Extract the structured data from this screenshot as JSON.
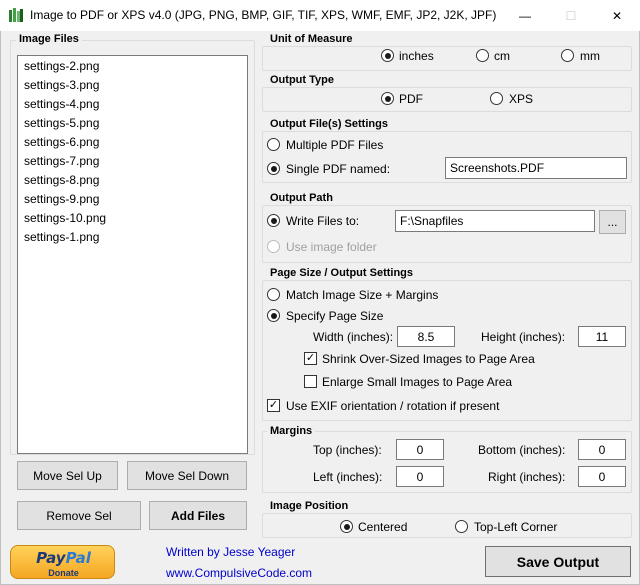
{
  "window": {
    "title": "Image to PDF or XPS  v4.0   (JPG, PNG, BMP, GIF, TIF, XPS, WMF, EMF, JP2, J2K, JPF)",
    "minimize_glyph": "—",
    "maximize_glyph": "☐",
    "close_glyph": "✕"
  },
  "image_files": {
    "title": "Image Files",
    "items": [
      "settings-2.png",
      "settings-3.png",
      "settings-4.png",
      "settings-5.png",
      "settings-6.png",
      "settings-7.png",
      "settings-8.png",
      "settings-9.png",
      "settings-10.png",
      "settings-1.png"
    ],
    "move_up_label": "Move Sel Up",
    "move_down_label": "Move Sel Down",
    "remove_label": "Remove Sel",
    "add_label": "Add Files"
  },
  "unit_of_measure": {
    "title": "Unit of Measure",
    "options": [
      "inches",
      "cm",
      "mm"
    ],
    "selected": "inches"
  },
  "output_type": {
    "title": "Output Type",
    "options": [
      "PDF",
      "XPS"
    ],
    "selected": "PDF"
  },
  "output_file_settings": {
    "title": "Output File(s) Settings",
    "multiple_label": "Multiple PDF Files",
    "single_label": "Single PDF named:",
    "selected": "single",
    "filename": "Screenshots.PDF"
  },
  "output_path": {
    "title": "Output Path",
    "write_label": "Write Files to:",
    "path": "F:\\Snapfiles",
    "browse_label": "...",
    "use_image_folder_label": "Use image folder",
    "selected": "write"
  },
  "page_size": {
    "title": "Page Size / Output Settings",
    "match_label": "Match Image Size + Margins",
    "specify_label": "Specify Page Size",
    "selected": "specify",
    "width_label": "Width (inches):",
    "width_value": "8.5",
    "height_label": "Height (inches):",
    "height_value": "11",
    "shrink_label": "Shrink Over-Sized Images to Page Area",
    "shrink_checked": true,
    "enlarge_label": "Enlarge Small Images to Page Area",
    "enlarge_checked": false,
    "exif_label": "Use EXIF orientation / rotation if present",
    "exif_checked": true,
    "check_glyph": "✓"
  },
  "margins": {
    "title": "Margins",
    "top_label": "Top (inches):",
    "top_value": "0",
    "bottom_label": "Bottom (inches):",
    "bottom_value": "0",
    "left_label": "Left (inches):",
    "left_value": "0",
    "right_label": "Right (inches):",
    "right_value": "0"
  },
  "image_position": {
    "title": "Image Position",
    "options": [
      "Centered",
      "Top-Left Corner"
    ],
    "selected": "Centered"
  },
  "footer": {
    "paypal_pay": "Pay",
    "paypal_pal": "Pal",
    "paypal_donate": "Donate",
    "author": "Written by Jesse Yeager",
    "website": "www.CompulsiveCode.com",
    "save_label": "Save Output"
  },
  "colors": {
    "link": "#0000cc",
    "paypal_gold": "#f5a623",
    "paypal_blue": "#1b3a7a"
  }
}
